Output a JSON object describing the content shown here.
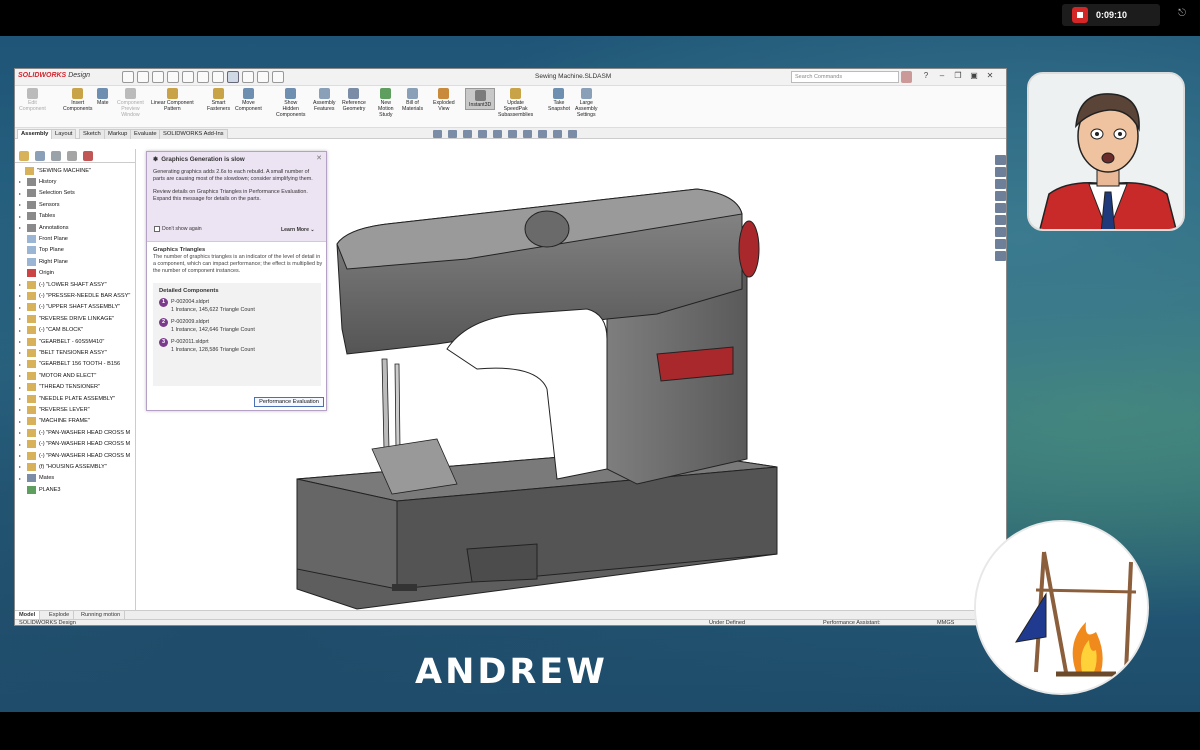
{
  "recorder": {
    "time": "0:09:10"
  },
  "app": {
    "logo": "SOLIDWORKS",
    "logo_suffix": "Design",
    "document_title": "Sewing Machine.SLDASM",
    "search_placeholder": "Search Commands"
  },
  "ribbon": [
    {
      "label": "Edit\nComponent",
      "disabled": true
    },
    {
      "label": "Insert\nComponents",
      "disabled": false
    },
    {
      "label": "Mate",
      "disabled": false
    },
    {
      "label": "Component\nPreview\nWindow",
      "disabled": true
    },
    {
      "label": "Linear Component\nPattern",
      "disabled": false
    },
    {
      "label": "Smart\nFasteners",
      "disabled": false
    },
    {
      "label": "Move\nComponent",
      "disabled": false
    },
    {
      "label": "Show\nHidden\nComponents",
      "disabled": false
    },
    {
      "label": "Assembly\nFeatures",
      "disabled": false
    },
    {
      "label": "Reference\nGeometry",
      "disabled": false
    },
    {
      "label": "New\nMotion\nStudy",
      "disabled": false
    },
    {
      "label": "Bill of\nMaterials",
      "disabled": false
    },
    {
      "label": "Exploded\nView",
      "disabled": false
    },
    {
      "label": "Instant3D",
      "disabled": false,
      "active": true
    },
    {
      "label": "Update\nSpeedPak\nSubassemblies",
      "disabled": false
    },
    {
      "label": "Take\nSnapshot",
      "disabled": false
    },
    {
      "label": "Large\nAssembly\nSettings",
      "disabled": false
    }
  ],
  "tabs": [
    "Assembly",
    "Layout",
    "Sketch",
    "Markup",
    "Evaluate",
    "SOLIDWORKS Add-Ins"
  ],
  "tree": [
    "\"SEWING MACHINE\"",
    "History",
    "Selection Sets",
    "Sensors",
    "Tables",
    "Annotations",
    "Front Plane",
    "Top Plane",
    "Right Plane",
    "Origin",
    "(-) \"LOWER SHAFT ASSY\"",
    "(-) \"PRESSER-NEEDLE BAR ASSY\"",
    "(-) \"UPPER SHAFT ASSEMBLY\"",
    "\"REVERSE DRIVE LINKAGE\"",
    "(-) \"CAM BLOCK\"",
    "\"GEARBELT - 60S5M410\"",
    "\"BELT TENSIONER ASSY\"",
    "\"GEARBELT 156 TOOTH - B156",
    "\"MOTOR AND ELECT\"",
    "\"THREAD TENSIONER\"",
    "\"NEEDLE PLATE ASSEMBLY\"",
    "\"REVERSE LEVER\"",
    "\"MACHINE FRAME\"",
    "(-) \"PAN-WASHER HEAD CROSS M",
    "(-) \"PAN-WASHER HEAD CROSS M",
    "(-) \"PAN-WASHER HEAD CROSS M",
    "(f) \"HOUSING ASSEMBLY\"",
    "Mates",
    "PLANE3"
  ],
  "popup": {
    "title": "Graphics Generation is slow",
    "para1": "Generating graphics adds 2.6s to each rebuild.  A small number of parts are causing most of the slowdown; consider simplifying them.",
    "para2": "Review details on Graphics Triangles in Performance Evaluation.  Expand this message for details on the parts.",
    "dont_show": "Don't show again",
    "learn_more": "Learn More",
    "subtitle": "Graphics Triangles",
    "para3": "The number of graphics triangles is an indicator of the level of detail in a component, which can impact performance; the effect is multiplied by the number of component instances.",
    "details_title": "Detailed Components",
    "components": [
      {
        "num": "1",
        "name": "P-002004.sldprt",
        "info": "1 Instance, 145,622 Triangle Count"
      },
      {
        "num": "2",
        "name": "P-002009.sldprt",
        "info": "1 Instance, 142,646 Triangle Count"
      },
      {
        "num": "3",
        "name": "P-002011.sldprt",
        "info": "1 Instance, 128,586 Triangle Count"
      }
    ],
    "button": "Performance Evaluation"
  },
  "bottom_tabs": [
    "Model",
    "Explode",
    "Running motion"
  ],
  "status": {
    "left": "SOLIDWORKS Design",
    "state": "Under Defined",
    "assistant": "Performance Assistant:",
    "units": "MMGS"
  },
  "presenter_name": "ANDREW",
  "colors": {
    "accent_red": "#d2252e",
    "popup_purple": "#7b3b8c",
    "machine_gray": "#6e6e6e",
    "machine_red": "#a8282c"
  }
}
